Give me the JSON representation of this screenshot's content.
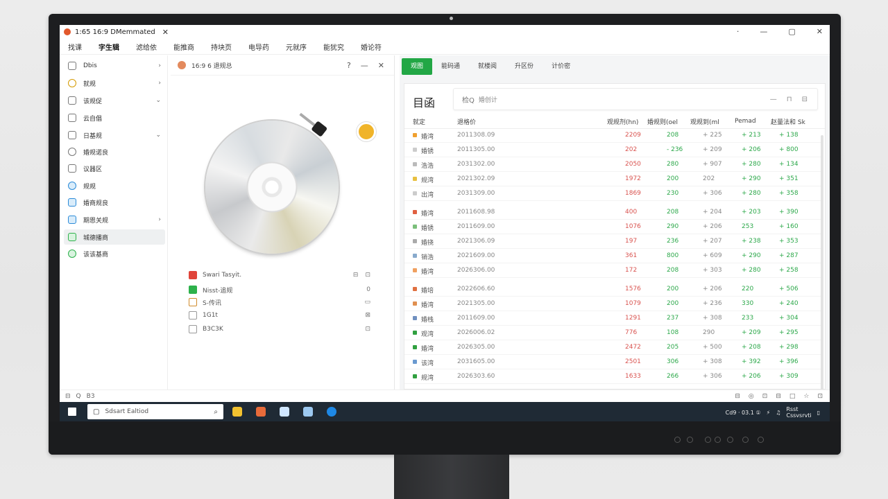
{
  "window": {
    "title": "1:65   16:9   DMemmated",
    "close_symbol": "✕",
    "controls": [
      "·",
      "—",
      "▢",
      "✕"
    ]
  },
  "menu": [
    "找课",
    "字生辑",
    "滤给依",
    "能推商",
    "持块页",
    "电导药",
    "元就序",
    "能犹究",
    "婚论符"
  ],
  "sidebar": {
    "items": [
      {
        "label": "Dbis",
        "arrow": "›"
      },
      {
        "label": "就规",
        "arrow": "›"
      },
      {
        "label": "该规促",
        "arrow": "⌄"
      },
      {
        "label": "云自倡",
        "arrow": ""
      },
      {
        "label": "日基规",
        "arrow": "⌄"
      },
      {
        "label": "婚规诺良",
        "arrow": ""
      },
      {
        "label": "议器区",
        "arrow": ""
      },
      {
        "label": "规规",
        "arrow": ""
      },
      {
        "label": "婚商规良",
        "arrow": ""
      },
      {
        "label": "期恩关规",
        "arrow": "›"
      },
      {
        "label": "城德播商",
        "arrow": ""
      },
      {
        "label": "该该基商",
        "arrow": ""
      }
    ],
    "active_index": 10
  },
  "middle": {
    "header_title": "16:9  6 退规总",
    "header_controls": [
      "?",
      "—",
      "✕"
    ],
    "files": [
      {
        "name": "Swari Tasyit.",
        "actions": [
          "⊟",
          "⊡"
        ]
      },
      {
        "name": "Nisst-追规",
        "actions": [
          "0"
        ]
      },
      {
        "name": "S-传讯",
        "actions": [
          "▭"
        ]
      },
      {
        "name": "1G1t",
        "actions": [
          "⊠"
        ]
      },
      {
        "name": "B3C3K",
        "actions": [
          "⊡"
        ]
      }
    ]
  },
  "right": {
    "tabs": [
      "观图",
      "能码通",
      "就楼阅",
      "升区份",
      "计价密"
    ],
    "active_tab": 0,
    "card_title": "目函",
    "search_placeholder": "婚创计",
    "search_icon_text": "检Q",
    "search_actions": [
      "—",
      "⊓",
      "⊟"
    ],
    "columns": [
      "就定",
      "退格价",
      "观规剂(hn)",
      "婚规则(oel",
      "观规到(ml",
      "Pemad",
      "赵量法和 Sk"
    ],
    "rows": [
      {
        "name": "婚湾",
        "date": "2011308.09",
        "v1": "2209",
        "v2": "208",
        "v3": "+ 225",
        "v4": "+ 213",
        "v5": "+ 138",
        "color": "#f0a030"
      },
      {
        "name": "婚锈",
        "date": "2011305.00",
        "v1": "202",
        "v2": "- 236",
        "v3": "+ 209",
        "v4": "+ 206",
        "v5": "+ 800",
        "color": "#cccccc"
      },
      {
        "name": "浩浩",
        "date": "2031302.00",
        "v1": "2050",
        "v2": "280",
        "v3": "+ 907",
        "v4": "+ 280",
        "v5": "+ 134",
        "color": "#bbbbbb"
      },
      {
        "name": "规湾",
        "date": "2021302.09",
        "v1": "1972",
        "v2": "200",
        "v3": "202",
        "v4": "+ 290",
        "v5": "+ 351",
        "color": "#e8c040"
      },
      {
        "name": "出湾",
        "date": "2031309.00",
        "v1": "1869",
        "v2": "230",
        "v3": "+ 306",
        "v4": "+ 280",
        "v5": "+ 358",
        "color": "#cccccc"
      },
      {
        "name": "婚湾",
        "date": "2011608.98",
        "v1": "400",
        "v2": "208",
        "v3": "+ 204",
        "v4": "+ 203",
        "v5": "+ 390",
        "color": "#e06040"
      },
      {
        "name": "婚锈",
        "date": "2011609.00",
        "v1": "1076",
        "v2": "290",
        "v3": "+ 206",
        "v4": "253",
        "v5": "+ 160",
        "color": "#7bbf7b"
      },
      {
        "name": "婚挠",
        "date": "2021306.09",
        "v1": "197",
        "v2": "236",
        "v3": "+ 207",
        "v4": "+ 238",
        "v5": "+ 353",
        "color": "#aaaaaa"
      },
      {
        "name": "销浩",
        "date": "2021609.00",
        "v1": "361",
        "v2": "800",
        "v3": "+ 609",
        "v4": "+ 290",
        "v5": "+ 287",
        "color": "#88aacc"
      },
      {
        "name": "婚湾",
        "date": "2026306.00",
        "v1": "172",
        "v2": "208",
        "v3": "+ 303",
        "v4": "+ 280",
        "v5": "+ 258",
        "color": "#f0a060"
      },
      {
        "name": "婚培",
        "date": "2022606.60",
        "v1": "1576",
        "v2": "200",
        "v3": "+ 206",
        "v4": "220",
        "v5": "+ 506",
        "color": "#e07040"
      },
      {
        "name": "婚湾",
        "date": "2021305.00",
        "v1": "1079",
        "v2": "200",
        "v3": "+ 236",
        "v4": "330",
        "v5": "+ 240",
        "color": "#e09050"
      },
      {
        "name": "婚栈",
        "date": "2011609.00",
        "v1": "1291",
        "v2": "237",
        "v3": "+ 308",
        "v4": "233",
        "v5": "+ 304",
        "color": "#7090c0"
      },
      {
        "name": "观湾",
        "date": "2026006.02",
        "v1": "776",
        "v2": "108",
        "v3": "290",
        "v4": "+ 209",
        "v5": "+ 295",
        "color": "#30a040"
      },
      {
        "name": "婚湾",
        "date": "2026305.00",
        "v1": "2472",
        "v2": "205",
        "v3": "+ 500",
        "v4": "+ 208",
        "v5": "+ 298",
        "color": "#30a040"
      },
      {
        "name": "该湾",
        "date": "2031605.00",
        "v1": "2501",
        "v2": "306",
        "v3": "+ 308",
        "v4": "+ 392",
        "v5": "+ 396",
        "color": "#6a9ad0"
      },
      {
        "name": "规湾",
        "date": "2026303.60",
        "v1": "1633",
        "v2": "266",
        "v3": "+ 306",
        "v4": "+ 206",
        "v5": "+ 309",
        "color": "#30a040"
      }
    ]
  },
  "statusbar": {
    "left": [
      "⊟",
      "Q",
      "B3"
    ],
    "right": [
      "⊟",
      "◎",
      "⊡",
      "⊟",
      "□",
      "☆",
      "⊡"
    ]
  },
  "taskbar": {
    "search_text": "Sdsart Ealtiod",
    "clock": "Cd9 · 03.1 ①",
    "tray_small": "Rsst\nCssvsrvti"
  }
}
